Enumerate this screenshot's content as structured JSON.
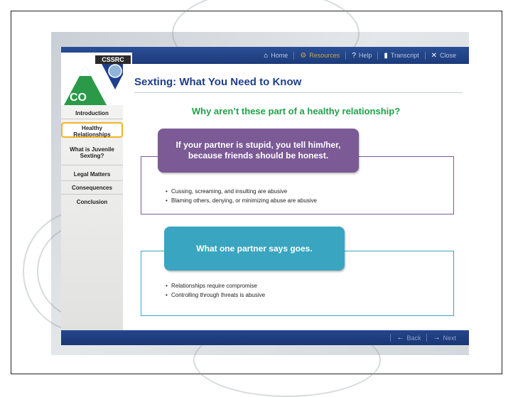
{
  "logo": {
    "brand_text": "CSSRC",
    "state_text": "CO"
  },
  "topnav": [
    {
      "label": "Home",
      "icon": "home-icon",
      "glyph": "⌂",
      "active": false
    },
    {
      "label": "Resources",
      "icon": "gear-icon",
      "glyph": "⚙",
      "active": true
    },
    {
      "label": "Help",
      "icon": "question-icon",
      "glyph": "?",
      "active": false
    },
    {
      "label": "Transcript",
      "icon": "document-icon",
      "glyph": "▮",
      "active": false
    },
    {
      "label": "Close",
      "icon": "close-icon",
      "glyph": "✕",
      "active": false
    }
  ],
  "sidebar": {
    "items": [
      {
        "label": "Introduction"
      },
      {
        "label": "Healthy Relationships",
        "current": true
      },
      {
        "label": "What is Juvenile Sexting?"
      },
      {
        "label": "Legal Matters"
      },
      {
        "label": "Consequences"
      },
      {
        "label": "Conclusion"
      }
    ]
  },
  "page": {
    "title": "Sexting: What You Need to Know",
    "question": "Why aren’t these part of a healthy relationship?"
  },
  "cards": [
    {
      "statement": "If your partner is stupid, you tell him/her, because friends should be honest.",
      "color": "#7b5a96",
      "border_color": "#7b5a96",
      "bullets": [
        "Cussing, screaming, and insulting are abusive",
        "Blaming others, denying, or minimizing abuse are abusive"
      ]
    },
    {
      "statement": "What one partner says goes.",
      "color": "#3aa5c0",
      "border_color": "#3aa5c0",
      "bullets": [
        "Relationships require compromise",
        "Controlling through threats is abusive"
      ]
    }
  ],
  "bottomnav": [
    {
      "label": "Back",
      "icon": "arrow-left-icon",
      "glyph": "←"
    },
    {
      "label": "Next",
      "icon": "arrow-right-icon",
      "glyph": "→"
    }
  ],
  "colors": {
    "topbar": "#1f4186",
    "title": "#1f3f8c",
    "question": "#21a14a",
    "highlight": "#f0b429"
  }
}
